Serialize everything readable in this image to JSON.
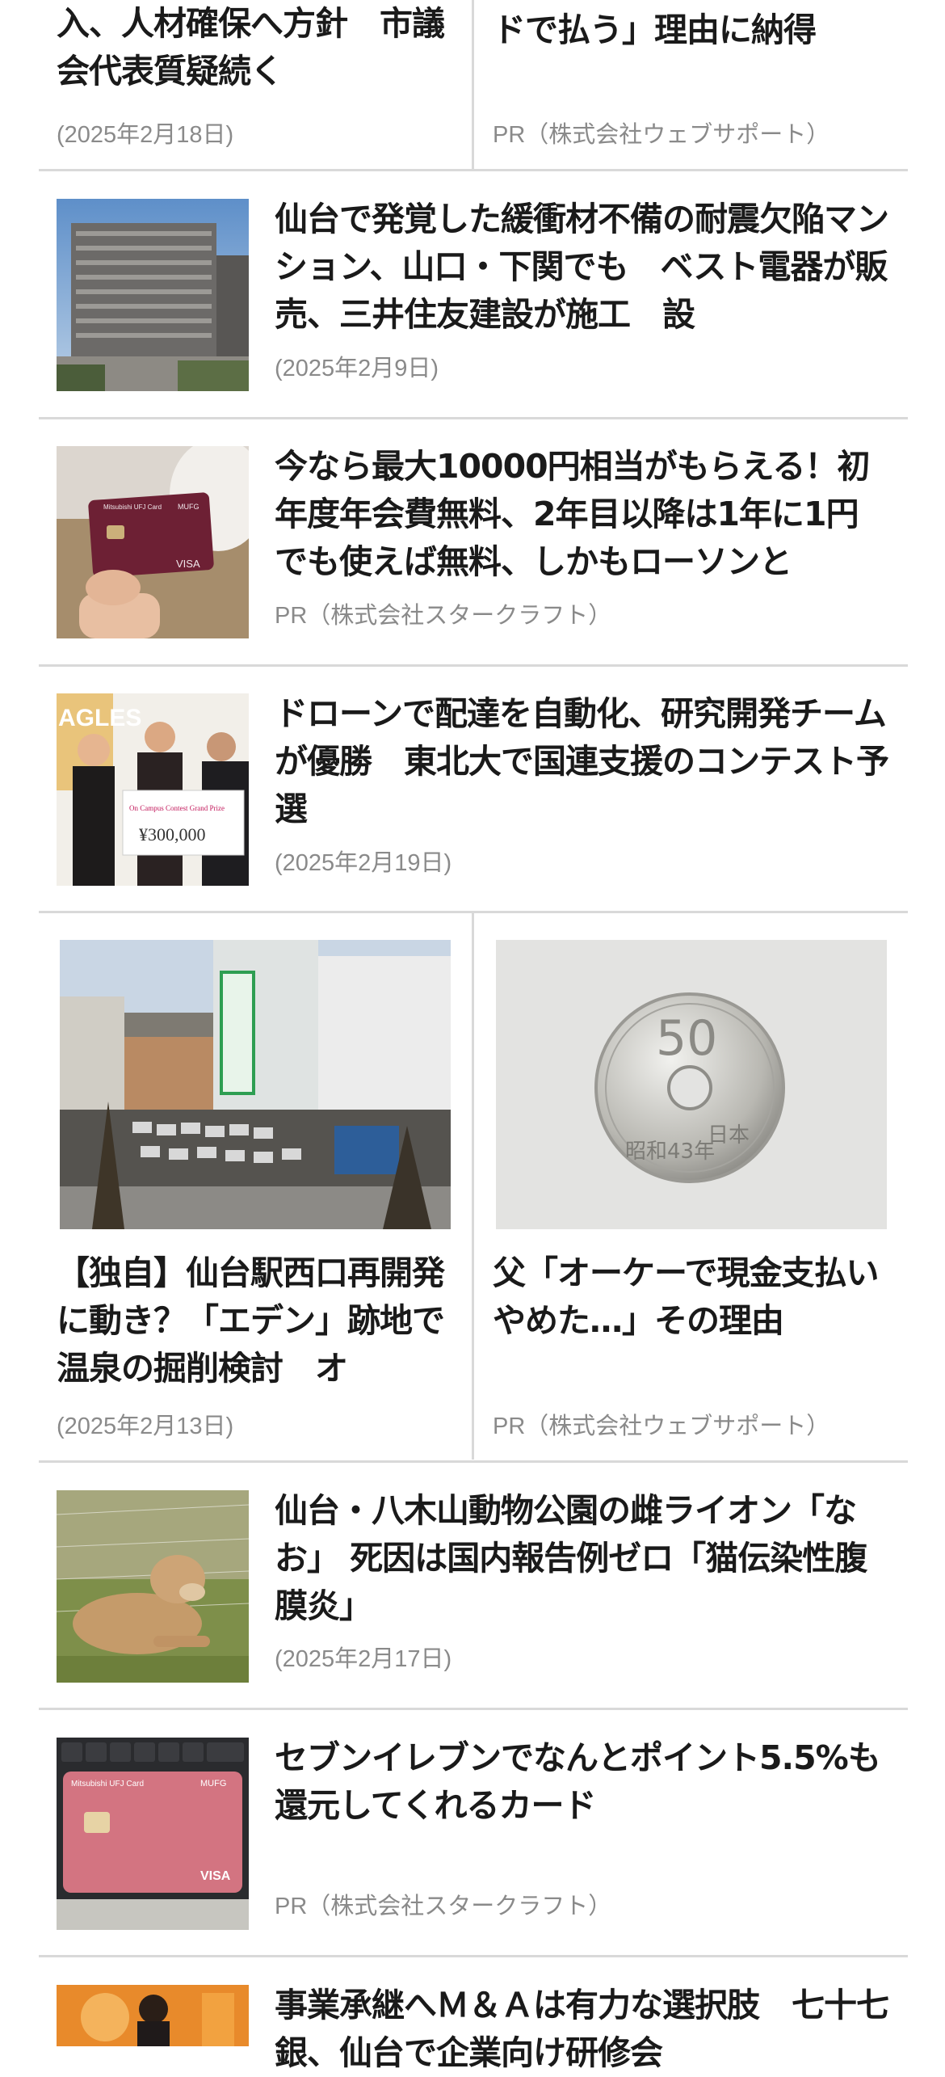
{
  "top_left": {
    "title": "入、人材確保へ方針　市議会代表質疑続く",
    "meta": "(2025年2月18日)"
  },
  "top_right": {
    "title": "ドで払う」理由に納得",
    "meta": "PR（株式会社ウェブサポート）"
  },
  "rows": [
    {
      "title": "仙台で発覚した緩衝材不備の耐震欠陥マンション、山口・下関でも　ベスト電器が販売、三井住友建設が施工　設",
      "meta": "(2025年2月9日)"
    },
    {
      "title": "今なら最大10000円相当がもらえる！初年度年会費無料、2年目以降は1年に1円でも使えば無料、しかもローソンと",
      "meta": "PR（株式会社スタークラフト）"
    },
    {
      "title": "ドローンで配達を自動化、研究開発チームが優勝　東北大で国連支援のコンテスト予選",
      "meta": "(2025年2月19日)"
    }
  ],
  "grid": [
    {
      "title": "【独自】仙台駅西口再開発に動き？「エデン」跡地で温泉の掘削検討　オ",
      "meta": "(2025年2月13日)"
    },
    {
      "title": "父「オーケーで現金支払いやめた…」その理由",
      "meta": "PR（株式会社ウェブサポート）"
    }
  ],
  "rows2": [
    {
      "title": "仙台・八木山動物公園の雌ライオン「なお」 死因は国内報告例ゼロ「猫伝染性腹膜炎」",
      "meta": "(2025年2月17日)"
    },
    {
      "title": "セブンイレブンでなんとポイント5.5%も還元してくれるカード",
      "meta": "PR（株式会社スタークラフト）"
    },
    {
      "title": "事業承継へＭ＆Ａは有力な選択肢　七十七銀、仙台で企業向け研修会"
    }
  ],
  "image_text": {
    "card_brand": "Mitsubishi UFJ Card",
    "card_bank": "MUFG",
    "card_network": "VISA",
    "banner_text": "AGLES",
    "check_title": "On Campus Contest Grand Prize",
    "check_amount": "¥300,000",
    "coin_value": "50",
    "coin_text": "昭和43年",
    "coin_country": "日本"
  }
}
